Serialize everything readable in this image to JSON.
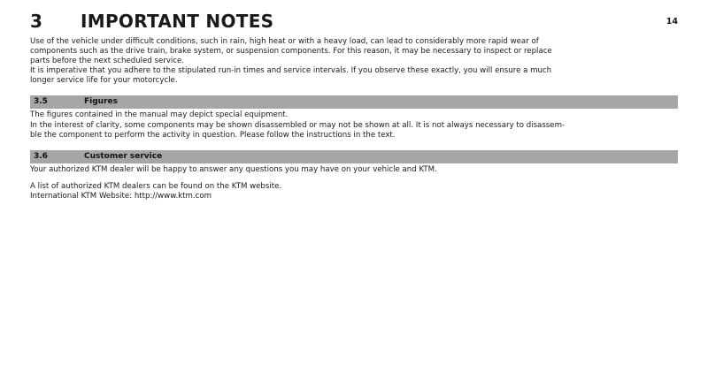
{
  "header": {
    "chapter_number": "3",
    "chapter_title": "IMPORTANT NOTES",
    "page_number": "14"
  },
  "intro": {
    "para1_line1": "Use of the vehicle under difficult conditions, such in rain, high heat or with a heavy load, can lead to considerably more rapid wear of",
    "para1_line2": "components such as the drive train, brake system, or suspension components. For this reason, it may be necessary to inspect or replace",
    "para1_line3": "parts before the next scheduled service.",
    "para2_line1": "It is imperative that you adhere to the stipulated run-in times and service intervals. If you observe these exactly, you will ensure a much",
    "para2_line2": "longer service life for your motorcycle."
  },
  "sections": [
    {
      "number": "3.5",
      "title": "Figures",
      "line1": "The figures contained in the manual may depict special equipment.",
      "line2": "In the interest of clarity, some components may be shown disassembled or may not be shown at all. It is not always necessary to disassem-",
      "line3": "ble the component to perform the activity in question. Please follow the instructions in the text."
    },
    {
      "number": "3.6",
      "title": "Customer service",
      "line1": "Your authorized KTM dealer will be happy to answer any questions you may have on your vehicle and KTM.",
      "line2": "A list of authorized KTM dealers can be found on the KTM website.",
      "line3": "International KTM Website: http://www.ktm.com"
    }
  ]
}
